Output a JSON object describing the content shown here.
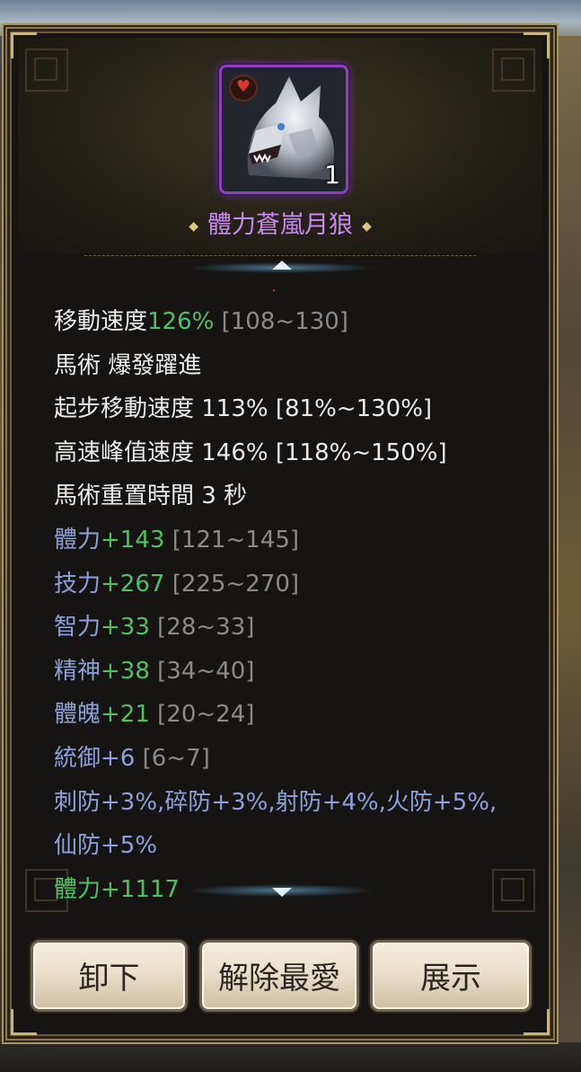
{
  "item": {
    "title": "體力蒼嵐月狼",
    "count": "1",
    "favorite_icon": "heart-icon",
    "portrait_icon": "wolf-icon",
    "rarity_color": "#8d3fc0"
  },
  "stats": {
    "move_speed": {
      "label": "移動速度",
      "value": "126%",
      "range": "[108~130]"
    },
    "skill": {
      "text": "馬術 爆發躍進"
    },
    "start_speed": {
      "text": "起步移動速度 113% [81%~130%]"
    },
    "peak_speed": {
      "text": "高速峰值速度 146% [118%~150%]"
    },
    "reset_time": {
      "text": "馬術重置時間 3 秒"
    },
    "attrs": [
      {
        "label": "體力",
        "value": "+143",
        "range": "[121~145]"
      },
      {
        "label": "技力",
        "value": "+267",
        "range": "[225~270]"
      },
      {
        "label": "智力",
        "value": "+33",
        "range": "[28~33]"
      },
      {
        "label": "精神",
        "value": "+38",
        "range": "[34~40]"
      },
      {
        "label": "體魄",
        "value": "+21",
        "range": "[20~24]"
      },
      {
        "label": "統御",
        "value": "+6",
        "range": "[6~7]"
      }
    ],
    "resist_text": "刺防+3%,碎防+3%,射防+4%,火防+5%,仙防+5%",
    "bonus": "體力+1117"
  },
  "buttons": {
    "unequip": "卸下",
    "unfavorite": "解除最愛",
    "show": "展示"
  },
  "colors": {
    "white_text": "#ebebeb",
    "green_value": "#4ec262",
    "blue_label": "#8ea0d8",
    "gray_range": "#8a8a8a",
    "title_purple": "#c989f0"
  }
}
